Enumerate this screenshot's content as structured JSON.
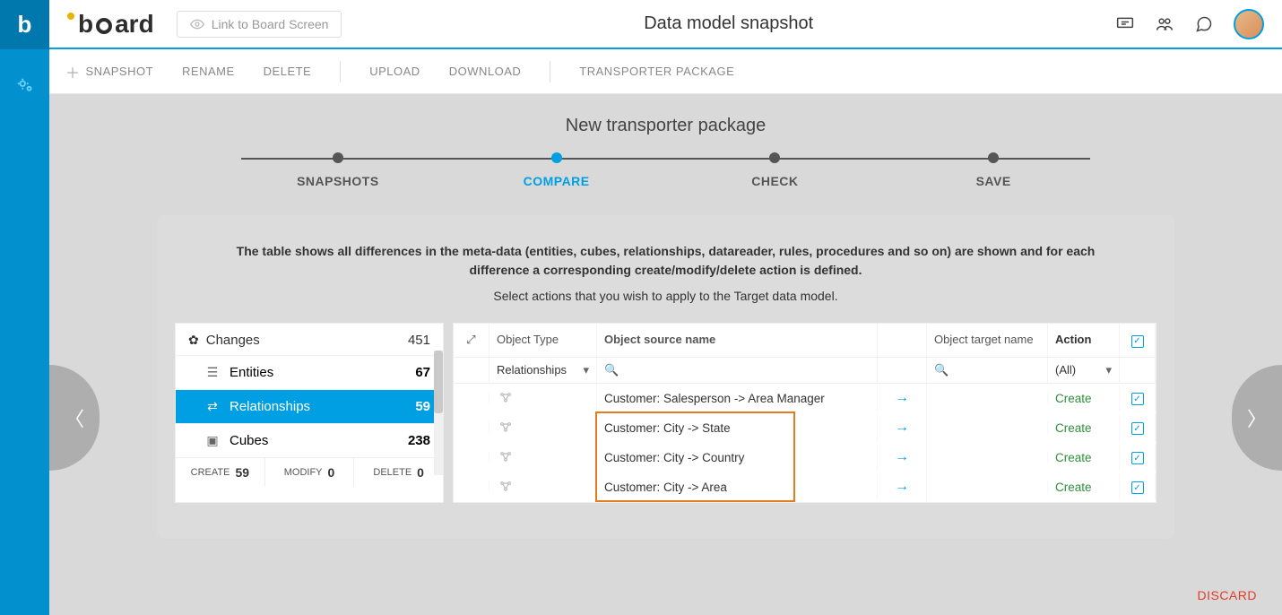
{
  "header": {
    "link_board": "Link to Board Screen",
    "page_title": "Data model snapshot"
  },
  "toolbar": {
    "snapshot": "SNAPSHOT",
    "rename": "RENAME",
    "delete": "DELETE",
    "upload": "UPLOAD",
    "download": "DOWNLOAD",
    "transporter": "TRANSPORTER PACKAGE"
  },
  "section_title": "New transporter package",
  "steps": {
    "s1": "SNAPSHOTS",
    "s2": "COMPARE",
    "s3": "CHECK",
    "s4": "SAVE"
  },
  "intro": "The table shows all differences in the meta-data (entities, cubes, relationships, datareader, rules, procedures and so on) are shown and for each difference a corresponding create/modify/delete action is defined.",
  "subintro": "Select actions that you wish to apply to the Target data model.",
  "changes": {
    "title": "Changes",
    "total": "451",
    "entities_label": "Entities",
    "entities_count": "67",
    "relationships_label": "Relationships",
    "relationships_count": "59",
    "cubes_label": "Cubes",
    "cubes_count": "238",
    "create_label": "CREATE",
    "create_count": "59",
    "modify_label": "MODIFY",
    "modify_count": "0",
    "delete_label": "DELETE",
    "delete_count": "0"
  },
  "table": {
    "headers": {
      "type": "Object Type",
      "src": "Object source name",
      "tgt": "Object target name",
      "action": "Action"
    },
    "filter": {
      "type": "Relationships",
      "action": "(All)"
    },
    "rows": [
      {
        "src": "Customer: Salesperson -> Area Manager",
        "action": "Create",
        "hl": false
      },
      {
        "src": "Customer: City -> State",
        "action": "Create",
        "hl": true
      },
      {
        "src": "Customer: City -> Country",
        "action": "Create",
        "hl": true
      },
      {
        "src": "Customer: City -> Area",
        "action": "Create",
        "hl": true
      }
    ]
  },
  "discard": "DISCARD"
}
